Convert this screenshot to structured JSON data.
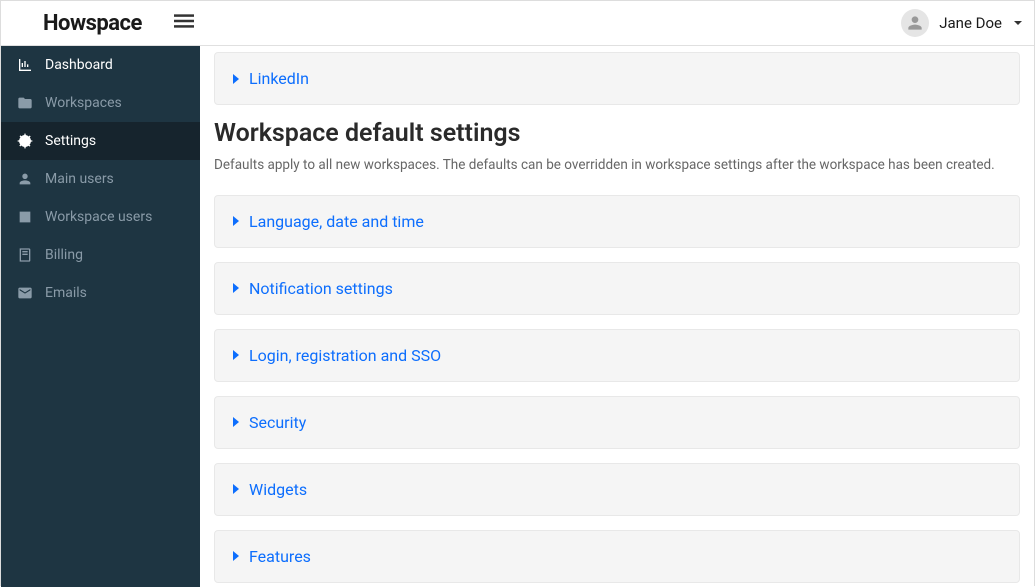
{
  "header": {
    "logo": "Howspace",
    "username": "Jane Doe"
  },
  "sidebar": {
    "items": [
      {
        "label": "Dashboard",
        "icon": "chart-icon",
        "highlight": true
      },
      {
        "label": "Workspaces",
        "icon": "folder-icon"
      },
      {
        "label": "Settings",
        "icon": "gears-icon",
        "active": true
      },
      {
        "label": "Main users",
        "icon": "user-icon"
      },
      {
        "label": "Workspace users",
        "icon": "address-icon"
      },
      {
        "label": "Billing",
        "icon": "book-icon"
      },
      {
        "label": "Emails",
        "icon": "envelope-icon"
      }
    ]
  },
  "content": {
    "topAccordion": {
      "label": "LinkedIn"
    },
    "sectionHeading": "Workspace default settings",
    "sectionSubtext": "Defaults apply to all new workspaces. The defaults can be overridden in workspace settings after the workspace has been created.",
    "accordions": [
      {
        "label": "Language, date and time"
      },
      {
        "label": "Notification settings"
      },
      {
        "label": "Login, registration and SSO"
      },
      {
        "label": "Security"
      },
      {
        "label": "Widgets"
      },
      {
        "label": "Features"
      }
    ]
  }
}
